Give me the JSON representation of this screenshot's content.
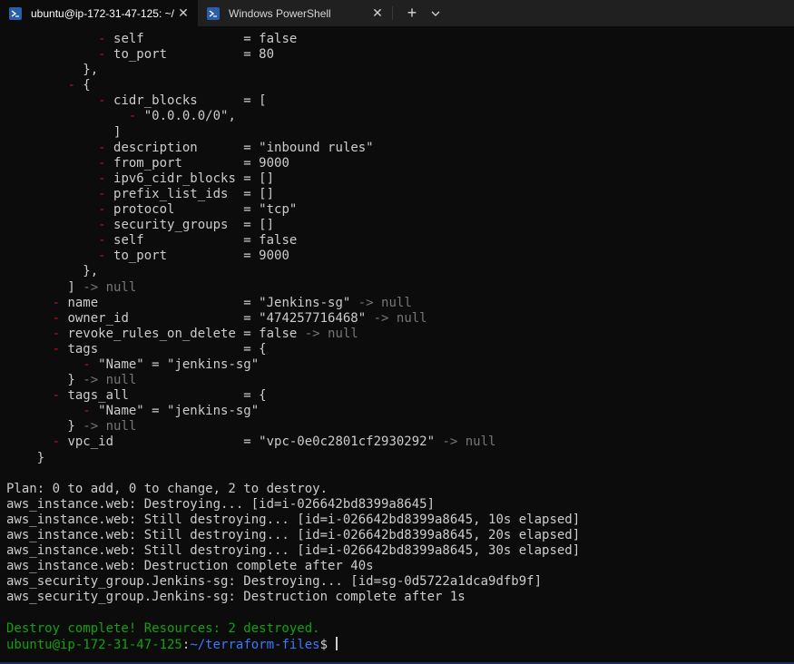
{
  "tabs": [
    {
      "title": "ubuntu@ip-172-31-47-125: ~/",
      "active": true,
      "icon": "powershell-icon"
    },
    {
      "title": "Windows PowerShell",
      "active": false,
      "icon": "powershell-icon"
    }
  ],
  "tabbar": {
    "new_tab": "+",
    "close": "✕"
  },
  "colors": {
    "removed": "#c50f1f",
    "null": "#767676",
    "success": "#13a10e",
    "path": "#3b78ff",
    "text": "#cccccc",
    "background": "#0c0c0c"
  },
  "lines": [
    {
      "segs": [
        {
          "t": "            "
        },
        {
          "t": "-",
          "c": "r"
        },
        {
          "t": " self             = false"
        }
      ]
    },
    {
      "segs": [
        {
          "t": "            "
        },
        {
          "t": "-",
          "c": "r"
        },
        {
          "t": " to_port          = 80"
        }
      ]
    },
    {
      "segs": [
        {
          "t": "          },"
        }
      ]
    },
    {
      "segs": [
        {
          "t": "        "
        },
        {
          "t": "-",
          "c": "r"
        },
        {
          "t": " {"
        }
      ]
    },
    {
      "segs": [
        {
          "t": "            "
        },
        {
          "t": "-",
          "c": "r"
        },
        {
          "t": " cidr_blocks      = ["
        }
      ]
    },
    {
      "segs": [
        {
          "t": "                "
        },
        {
          "t": "-",
          "c": "r"
        },
        {
          "t": " \"0.0.0.0/0\","
        }
      ]
    },
    {
      "segs": [
        {
          "t": "              ]"
        }
      ]
    },
    {
      "segs": [
        {
          "t": "            "
        },
        {
          "t": "-",
          "c": "r"
        },
        {
          "t": " description      = \"inbound rules\""
        }
      ]
    },
    {
      "segs": [
        {
          "t": "            "
        },
        {
          "t": "-",
          "c": "r"
        },
        {
          "t": " from_port        = 9000"
        }
      ]
    },
    {
      "segs": [
        {
          "t": "            "
        },
        {
          "t": "-",
          "c": "r"
        },
        {
          "t": " ipv6_cidr_blocks = []"
        }
      ]
    },
    {
      "segs": [
        {
          "t": "            "
        },
        {
          "t": "-",
          "c": "r"
        },
        {
          "t": " prefix_list_ids  = []"
        }
      ]
    },
    {
      "segs": [
        {
          "t": "            "
        },
        {
          "t": "-",
          "c": "r"
        },
        {
          "t": " protocol         = \"tcp\""
        }
      ]
    },
    {
      "segs": [
        {
          "t": "            "
        },
        {
          "t": "-",
          "c": "r"
        },
        {
          "t": " security_groups  = []"
        }
      ]
    },
    {
      "segs": [
        {
          "t": "            "
        },
        {
          "t": "-",
          "c": "r"
        },
        {
          "t": " self             = false"
        }
      ]
    },
    {
      "segs": [
        {
          "t": "            "
        },
        {
          "t": "-",
          "c": "r"
        },
        {
          "t": " to_port          = 9000"
        }
      ]
    },
    {
      "segs": [
        {
          "t": "          },"
        }
      ]
    },
    {
      "segs": [
        {
          "t": "        ]"
        },
        {
          "t": " -> null",
          "c": "g"
        }
      ]
    },
    {
      "segs": [
        {
          "t": "      "
        },
        {
          "t": "-",
          "c": "r"
        },
        {
          "t": " name                   = \"Jenkins-sg\""
        },
        {
          "t": " -> null",
          "c": "g"
        }
      ]
    },
    {
      "segs": [
        {
          "t": "      "
        },
        {
          "t": "-",
          "c": "r"
        },
        {
          "t": " owner_id               = \"474257716468\""
        },
        {
          "t": " -> null",
          "c": "g"
        }
      ]
    },
    {
      "segs": [
        {
          "t": "      "
        },
        {
          "t": "-",
          "c": "r"
        },
        {
          "t": " revoke_rules_on_delete = false"
        },
        {
          "t": " -> null",
          "c": "g"
        }
      ]
    },
    {
      "segs": [
        {
          "t": "      "
        },
        {
          "t": "-",
          "c": "r"
        },
        {
          "t": " tags                   = {"
        }
      ]
    },
    {
      "segs": [
        {
          "t": "          "
        },
        {
          "t": "-",
          "c": "r"
        },
        {
          "t": " \"Name\" = \"jenkins-sg\""
        }
      ]
    },
    {
      "segs": [
        {
          "t": "        }"
        },
        {
          "t": " -> null",
          "c": "g"
        }
      ]
    },
    {
      "segs": [
        {
          "t": "      "
        },
        {
          "t": "-",
          "c": "r"
        },
        {
          "t": " tags_all               = {"
        }
      ]
    },
    {
      "segs": [
        {
          "t": "          "
        },
        {
          "t": "-",
          "c": "r"
        },
        {
          "t": " \"Name\" = \"jenkins-sg\""
        }
      ]
    },
    {
      "segs": [
        {
          "t": "        }"
        },
        {
          "t": " -> null",
          "c": "g"
        }
      ]
    },
    {
      "segs": [
        {
          "t": "      "
        },
        {
          "t": "-",
          "c": "r"
        },
        {
          "t": " vpc_id                 = \"vpc-0e0c2801cf2930292\""
        },
        {
          "t": " -> null",
          "c": "g"
        }
      ]
    },
    {
      "segs": [
        {
          "t": "    }"
        }
      ]
    },
    {
      "segs": [
        {
          "t": ""
        }
      ]
    },
    {
      "segs": [
        {
          "t": "Plan: 0 to add, 0 to change, 2 to destroy."
        }
      ]
    },
    {
      "segs": [
        {
          "t": "aws_instance.web: Destroying... [id=i-026642bd8399a8645]"
        }
      ]
    },
    {
      "segs": [
        {
          "t": "aws_instance.web: Still destroying... [id=i-026642bd8399a8645, 10s elapsed]"
        }
      ]
    },
    {
      "segs": [
        {
          "t": "aws_instance.web: Still destroying... [id=i-026642bd8399a8645, 20s elapsed]"
        }
      ]
    },
    {
      "segs": [
        {
          "t": "aws_instance.web: Still destroying... [id=i-026642bd8399a8645, 30s elapsed]"
        }
      ]
    },
    {
      "segs": [
        {
          "t": "aws_instance.web: Destruction complete after 40s"
        }
      ]
    },
    {
      "segs": [
        {
          "t": "aws_security_group.Jenkins-sg: Destroying... [id=sg-0d5722a1dca9dfb9f]"
        }
      ]
    },
    {
      "segs": [
        {
          "t": "aws_security_group.Jenkins-sg: Destruction complete after 1s"
        }
      ]
    },
    {
      "segs": [
        {
          "t": ""
        }
      ]
    },
    {
      "segs": [
        {
          "t": "Destroy complete! Resources: 2 destroyed.",
          "c": "ok"
        }
      ]
    }
  ],
  "prompt": {
    "user_host": "ubuntu@ip-172-31-47-125",
    "sep": ":",
    "path": "~/terraform-files",
    "symbol": "$ "
  }
}
